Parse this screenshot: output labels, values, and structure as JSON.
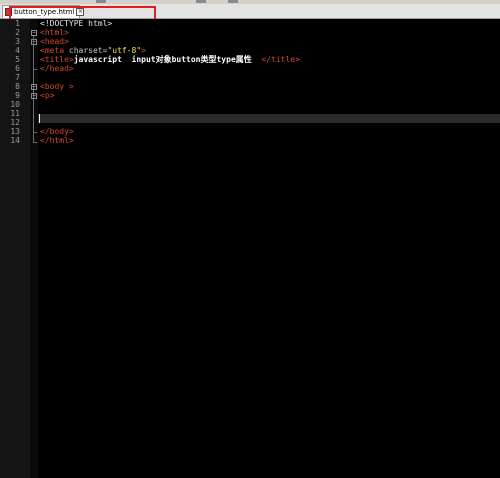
{
  "tab": {
    "label": "button_type.html",
    "close_glyph": "×"
  },
  "line_numbers": [
    "1",
    "2",
    "3",
    "4",
    "5",
    "6",
    "7",
    "8",
    "9",
    "10",
    "11",
    "12",
    "13",
    "14"
  ],
  "code": {
    "l1": "<!DOCTYPE html>",
    "l2_tag": "<html>",
    "l3_tag": "<head>",
    "l4_a": "<meta ",
    "l4_attr": "charset=",
    "l4_str": "\"utf-8\"",
    "l4_end": ">",
    "l5_open": "<title>",
    "l5_text": "javascript  input对象button类型type属性  ",
    "l5_close": "</title>",
    "l6_tag": "</head>",
    "l8_tag": "<body >",
    "l9_tag": "<p>",
    "l13_tag": "</body>",
    "l14_tag": "</html>"
  },
  "colors": {
    "background": "#000000",
    "tag": "#d04a2a",
    "string": "#f0e050",
    "highlight_border": "#e02020"
  }
}
